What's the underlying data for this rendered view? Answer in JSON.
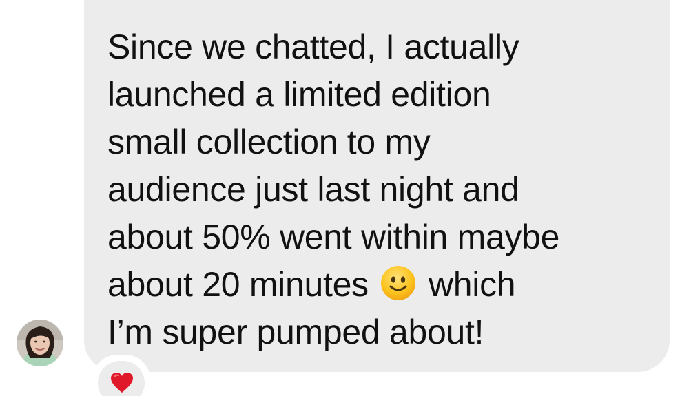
{
  "message": {
    "lines": [
      "Since we chatted, I actually",
      "launched a limited edition",
      "small collection to my",
      "audience just last night and",
      "about 50% went within maybe",
      "about 20 minutes",
      "which",
      "I’m super pumped about!"
    ],
    "inline_emoji": "slightly-smiling-face-icon"
  },
  "sender": {
    "avatar_icon": "user-avatar"
  },
  "reaction": {
    "icon": "red-heart-icon",
    "color": "#e0192a"
  },
  "colors": {
    "bubble": "#ececec",
    "text": "#111111",
    "background": "#ffffff"
  }
}
